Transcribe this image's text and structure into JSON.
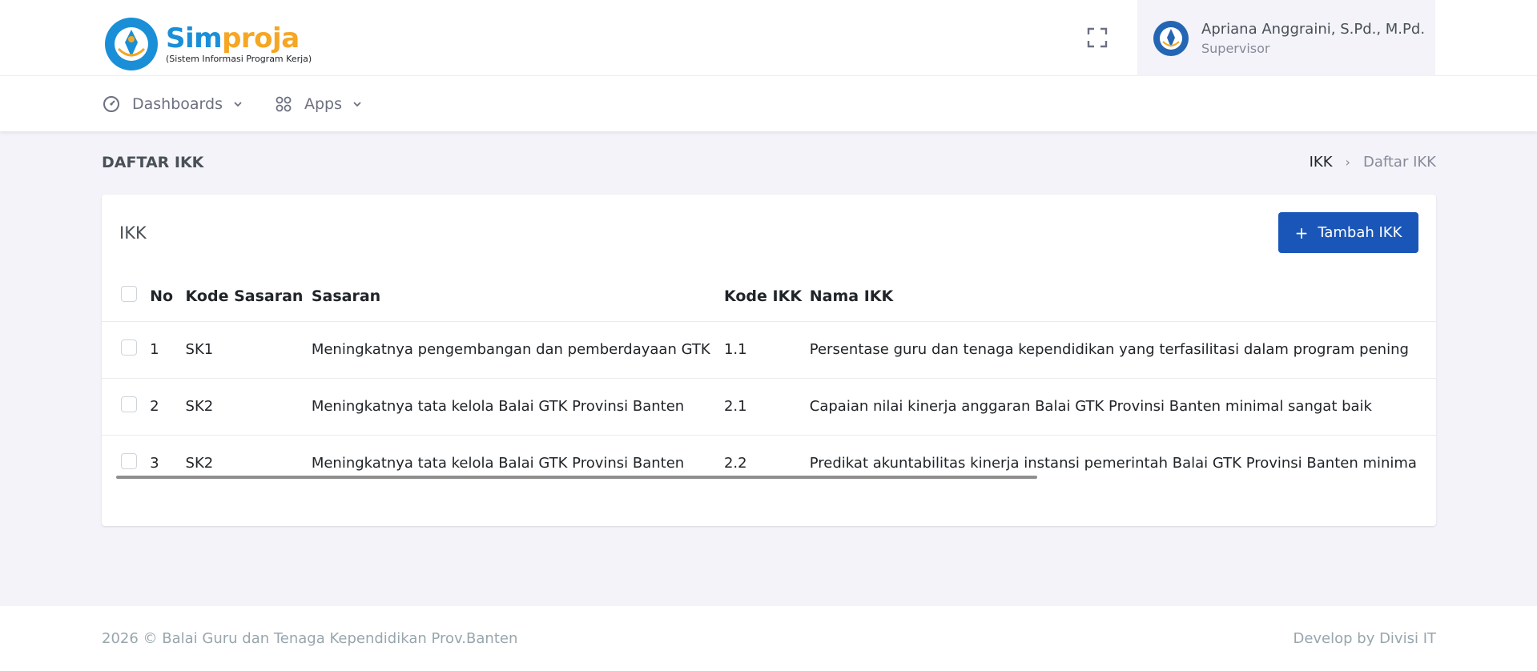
{
  "header": {
    "logo_title_part1": "Sim",
    "logo_title_part2": "proja",
    "logo_subtitle": "(Sistem Informasi Program Kerja)",
    "brand_blue": "#1a8fd8",
    "brand_orange": "#f5a623",
    "fullscreen_icon": "fullscreen-icon",
    "user": {
      "name": "Apriana Anggraini, S.Pd., M.Pd.",
      "role": "Supervisor"
    }
  },
  "nav": {
    "items": [
      {
        "label": "Dashboards",
        "icon": "dashboard-gauge-icon"
      },
      {
        "label": "Apps",
        "icon": "apps-grid-icon"
      }
    ]
  },
  "page": {
    "title": "DAFTAR IKK",
    "breadcrumb": [
      "IKK",
      "Daftar IKK"
    ]
  },
  "card": {
    "title": "IKK",
    "add_button_label": "Tambah IKK",
    "accent": "#1a56b8",
    "table": {
      "columns": [
        "No",
        "Kode Sasaran",
        "Sasaran",
        "Kode IKK",
        "Nama IKK"
      ],
      "rows": [
        {
          "no": "1",
          "kode_sasaran": "SK1",
          "sasaran": "Meningkatnya pengembangan dan pemberdayaan GTK",
          "kode_ikk": "1.1",
          "nama_ikk": "Persentase guru dan tenaga kependidikan yang terfasilitasi dalam program pening"
        },
        {
          "no": "2",
          "kode_sasaran": "SK2",
          "sasaran": "Meningkatnya tata kelola Balai GTK Provinsi Banten",
          "kode_ikk": "2.1",
          "nama_ikk": "Capaian nilai kinerja anggaran Balai GTK Provinsi Banten minimal sangat baik"
        },
        {
          "no": "3",
          "kode_sasaran": "SK2",
          "sasaran": "Meningkatnya tata kelola Balai GTK Provinsi Banten",
          "kode_ikk": "2.2",
          "nama_ikk": "Predikat akuntabilitas kinerja instansi pemerintah Balai GTK Provinsi Banten minima"
        }
      ]
    }
  },
  "footer": {
    "left": "2026 © Balai Guru dan Tenaga Kependidikan Prov.Banten",
    "right": "Develop by Divisi IT"
  }
}
